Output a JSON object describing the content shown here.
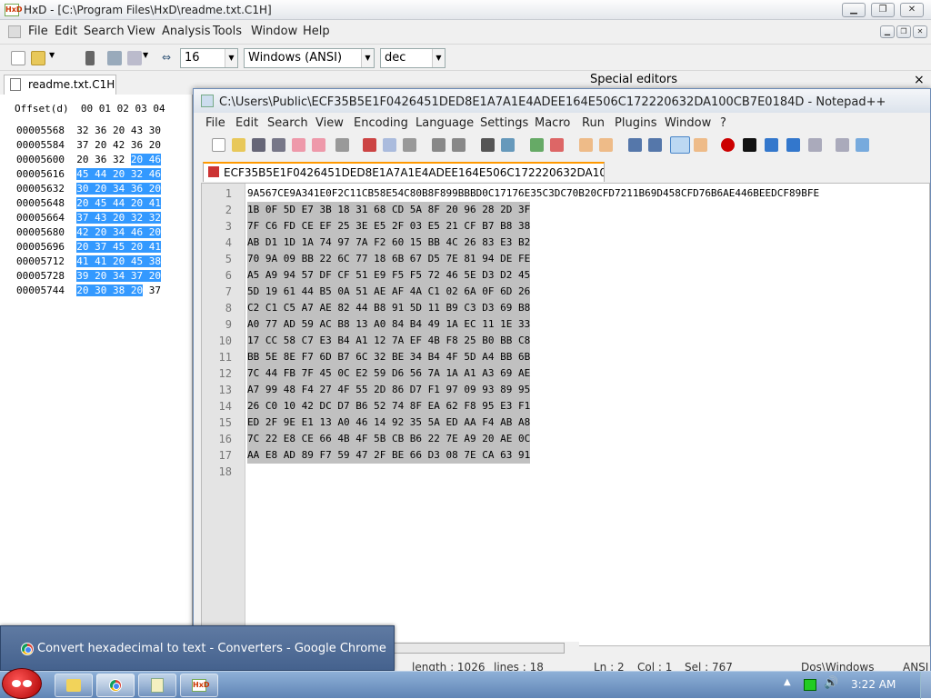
{
  "hxd": {
    "title": "HxD - [C:\\Program Files\\HxD\\readme.txt.C1H]",
    "menu": [
      "File",
      "Edit",
      "Search",
      "View",
      "Analysis",
      "Tools",
      "Window",
      "Help"
    ],
    "bytes_per_row": "16",
    "charset": "Windows (ANSI)",
    "offset_base": "dec",
    "tab": "readme.txt.C1H",
    "special_editors": "Special editors",
    "close_glyph": "×",
    "header": "Offset(d)  00 01 02 03 04",
    "rows": [
      {
        "offset": "00005568",
        "plain": "32 36 20 43 30",
        "sel": ""
      },
      {
        "offset": "00005584",
        "plain": "37 20 42 36 20",
        "sel": ""
      },
      {
        "offset": "00005600",
        "plain": "20 36 32 ",
        "sel": "20 46"
      },
      {
        "offset": "00005616",
        "plain": "",
        "sel": "45 44 20 32 46"
      },
      {
        "offset": "00005632",
        "plain": "",
        "sel": "30 20 34 36 20"
      },
      {
        "offset": "00005648",
        "plain": "",
        "sel": "20 45 44 20 41"
      },
      {
        "offset": "00005664",
        "plain": "",
        "sel": "37 43 20 32 32"
      },
      {
        "offset": "00005680",
        "plain": "",
        "sel": "42 20 34 46 20"
      },
      {
        "offset": "00005696",
        "plain": "",
        "sel": "20 37 45 20 41"
      },
      {
        "offset": "00005712",
        "plain": "",
        "sel": "41 41 20 45 38"
      },
      {
        "offset": "00005728",
        "plain": "",
        "sel": "39 20 34 37 20"
      },
      {
        "offset": "00005744",
        "plain": "",
        "sel": "20 30 38 20",
        "tail": " 37"
      }
    ]
  },
  "npp": {
    "title": "C:\\Users\\Public\\ECF35B5E1F0426451DED8E1A7A1E4ADEE164E506C172220632DA100CB7E0184D - Notepad++",
    "menu": [
      "File",
      "Edit",
      "Search",
      "View",
      "Encoding",
      "Language",
      "Settings",
      "Macro",
      "Run",
      "Plugins",
      "Window",
      "?"
    ],
    "tab": "ECF35B5E1F0426451DED8E1A7A1E4ADEE164E506C172220632DA100CB7E0184D",
    "lines": [
      "9A567CE9A341E0F2C11CB58E54C80B8F899BBBD0C17176E35C3DC70B20CFD7211B69D458CFD76B6AE446BEEDCF89BFE",
      "1B 0F 5D E7 3B 18 31 68 CD 5A 8F 20 96 28 2D 3F",
      "7F C6 FD CE EF 25 3E E5 2F 03 E5 21 CF B7 B8 38",
      "AB D1 1D 1A 74 97 7A F2 60 15 BB 4C 26 83 E3 B2",
      "70 9A 09 BB 22 6C 77 18 6B 67 D5 7E 81 94 DE FE",
      "A5 A9 94 57 DF CF 51 E9 F5 F5 72 46 5E D3 D2 45",
      "5D 19 61 44 B5 0A 51 AE AF 4A C1 02 6A 0F 6D 26",
      "C2 C1 C5 A7 AE 82 44 B8 91 5D 11 B9 C3 D3 69 B8",
      "A0 77 AD 59 AC B8 13 A0 84 B4 49 1A EC 11 1E 33",
      "17 CC 58 C7 E3 B4 A1 12 7A EF 4B F8 25 B0 BB C8",
      "BB 5E 8E F7 6D B7 6C 32 BE 34 B4 4F 5D A4 BB 6B",
      "7C 44 FB 7F 45 0C E2 59 D6 56 7A 1A A1 A3 69 AE",
      "A7 99 48 F4 27 4F 55 2D 86 D7 F1 97 09 93 89 95",
      "26 C0 10 42 DC D7 B6 52 74 8F EA 62 F8 95 E3 F1",
      "ED 2F 9E E1 13 A0 46 14 92 35 5A ED AA F4 AB A8",
      "7C 22 E8 CE 66 4B 4F 5B CB B6 22 7E A9 20 AE 0C",
      "AA E8 AD 89 F7 59 47 2F BE 66 D3 08 7E CA 63 91",
      ""
    ],
    "status": {
      "length": "length : 1026",
      "lines": "lines : 18",
      "ln": "Ln : 2",
      "col": "Col : 1",
      "sel": "Sel : 767",
      "eol": "Dos\\Windows",
      "enc": "ANSI"
    }
  },
  "popup": {
    "text": "Convert hexadecimal to text - Converters - Google Chrome"
  },
  "taskbar": {
    "clock": "3:22 AM"
  }
}
